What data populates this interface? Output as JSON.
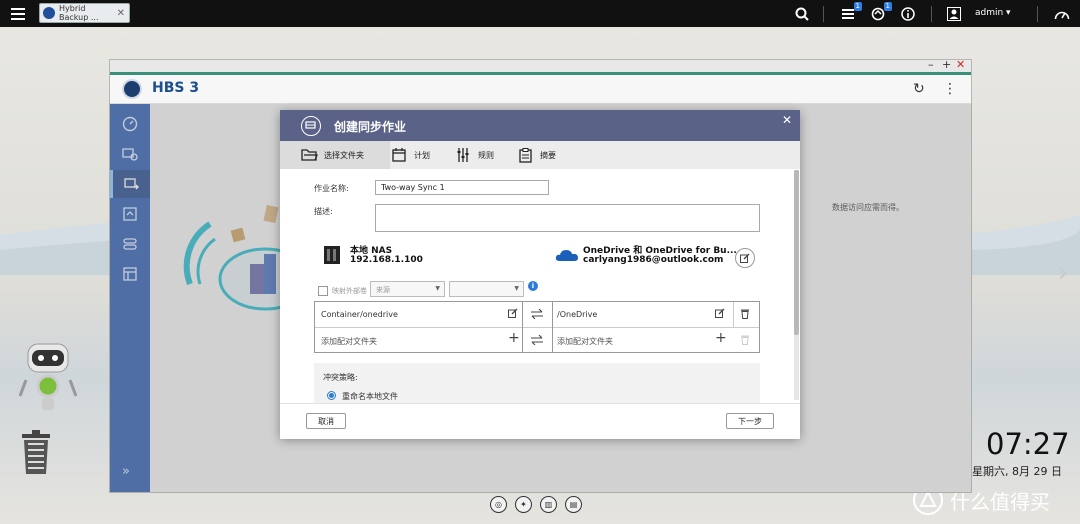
{
  "taskbar": {
    "app_tab_label": "Hybrid Backup ...",
    "badge_tasks": "1",
    "badge_sync": "1",
    "user": "admin ▾"
  },
  "window": {
    "title": "HBS 3",
    "bg_note": "数据访问应需而得。"
  },
  "desktop": {
    "time": "07:27",
    "date": "星期六, 8月 29 日",
    "watermark": "什么值得买"
  },
  "dialog": {
    "title": "创建同步作业",
    "steps": [
      "选择文件夹",
      "计划",
      "规则",
      "摘要"
    ],
    "active_step": 0,
    "job_name_label": "作业名称:",
    "job_name_value": "Two-way Sync 1",
    "description_label": "描述:",
    "description_value": "",
    "local": {
      "name": "本地 NAS",
      "address": "192.168.1.100"
    },
    "remote": {
      "name": "OneDrive 和 OneDrive for Bu...",
      "account": "carlyang1986@outlook.com"
    },
    "map_external_label": "映射外部卷",
    "source_select": "来源",
    "second_select": "",
    "pairs": [
      {
        "local": "Container/onedrive",
        "remote": "/OneDrive"
      }
    ],
    "add_local_placeholder": "添加配对文件夹",
    "add_remote_placeholder": "添加配对文件夹",
    "conflict_label": "冲突策略:",
    "conflict_option": "重命名本地文件",
    "cancel": "取消",
    "next": "下一步"
  }
}
